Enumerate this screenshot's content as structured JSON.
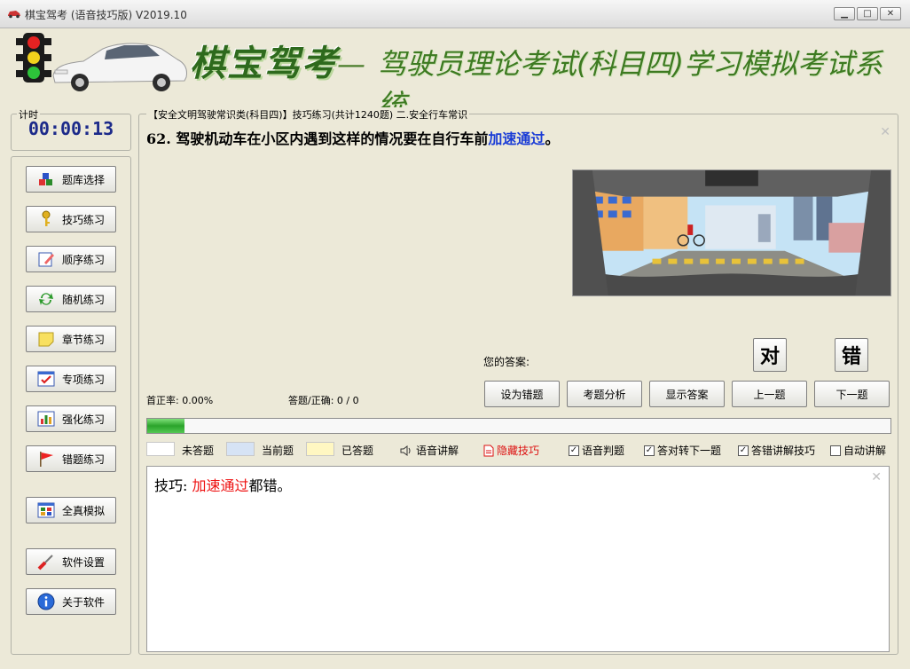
{
  "window": {
    "title": "棋宝驾考 (语音技巧版) V2019.10"
  },
  "banner": {
    "brand": "棋宝驾考",
    "dash": "—",
    "subtitle": "驾驶员理论考试(科目四)学习模拟考试系统"
  },
  "timer": {
    "label": "计时",
    "value": "00:00:13"
  },
  "menu": [
    {
      "id": "bank",
      "label": "题库选择",
      "icon": "cubes-icon"
    },
    {
      "id": "tips",
      "label": "技巧练习",
      "icon": "key-icon"
    },
    {
      "id": "seq",
      "label": "顺序练习",
      "icon": "pencil-notepad-icon"
    },
    {
      "id": "random",
      "label": "随机练习",
      "icon": "refresh-arrows-icon"
    },
    {
      "id": "chapter",
      "label": "章节练习",
      "icon": "sticky-note-icon"
    },
    {
      "id": "special",
      "label": "专项练习",
      "icon": "checkbox-window-icon"
    },
    {
      "id": "intense",
      "label": "强化练习",
      "icon": "bar-chart-icon"
    },
    {
      "id": "wrong",
      "label": "错题练习",
      "icon": "red-flag-icon"
    },
    {
      "id": "exam",
      "label": "全真模拟",
      "icon": "grid-window-icon"
    },
    {
      "id": "settings",
      "label": "软件设置",
      "icon": "screwdriver-icon"
    },
    {
      "id": "about",
      "label": "关于软件",
      "icon": "info-icon"
    }
  ],
  "main": {
    "breadcrumb": "【安全文明驾驶常识类(科目四)】技巧练习(共计1240题) 二.安全行车常识",
    "question_prefix": "62. 驾驶机动车在小区内遇到这样的情况要在自行车前",
    "question_highlight": "加速通过",
    "question_suffix": "。",
    "answer_label": "您的答案:",
    "judge_true": "对",
    "judge_false": "错",
    "first_correct_rate": "首正率: 0.00%",
    "answered_count": "答题/正确: 0 / 0",
    "buttons": {
      "mark_wrong": "设为错题",
      "analysis": "考题分析",
      "show_answer": "显示答案",
      "prev": "上一题",
      "next": "下一题"
    },
    "progress": 0.05,
    "legend": {
      "unanswered": "未答题",
      "current": "当前题",
      "answered": "已答题"
    },
    "colors": {
      "unanswered": "#ffffff",
      "current": "#d6e3f5",
      "answered": "#fff7c2"
    },
    "options": {
      "voice_explain": "语音讲解",
      "hide_tips": "隐藏技巧",
      "voice_judge": "语音判题",
      "correct_next": "答对转下一题",
      "wrong_explain": "答错讲解技巧",
      "auto_explain": "自动讲解"
    },
    "option_states": {
      "voice_judge": true,
      "correct_next": true,
      "wrong_explain": true,
      "auto_explain": false
    },
    "tip_prefix": "技巧: ",
    "tip_highlight": "加速通过",
    "tip_suffix": "都错。"
  }
}
